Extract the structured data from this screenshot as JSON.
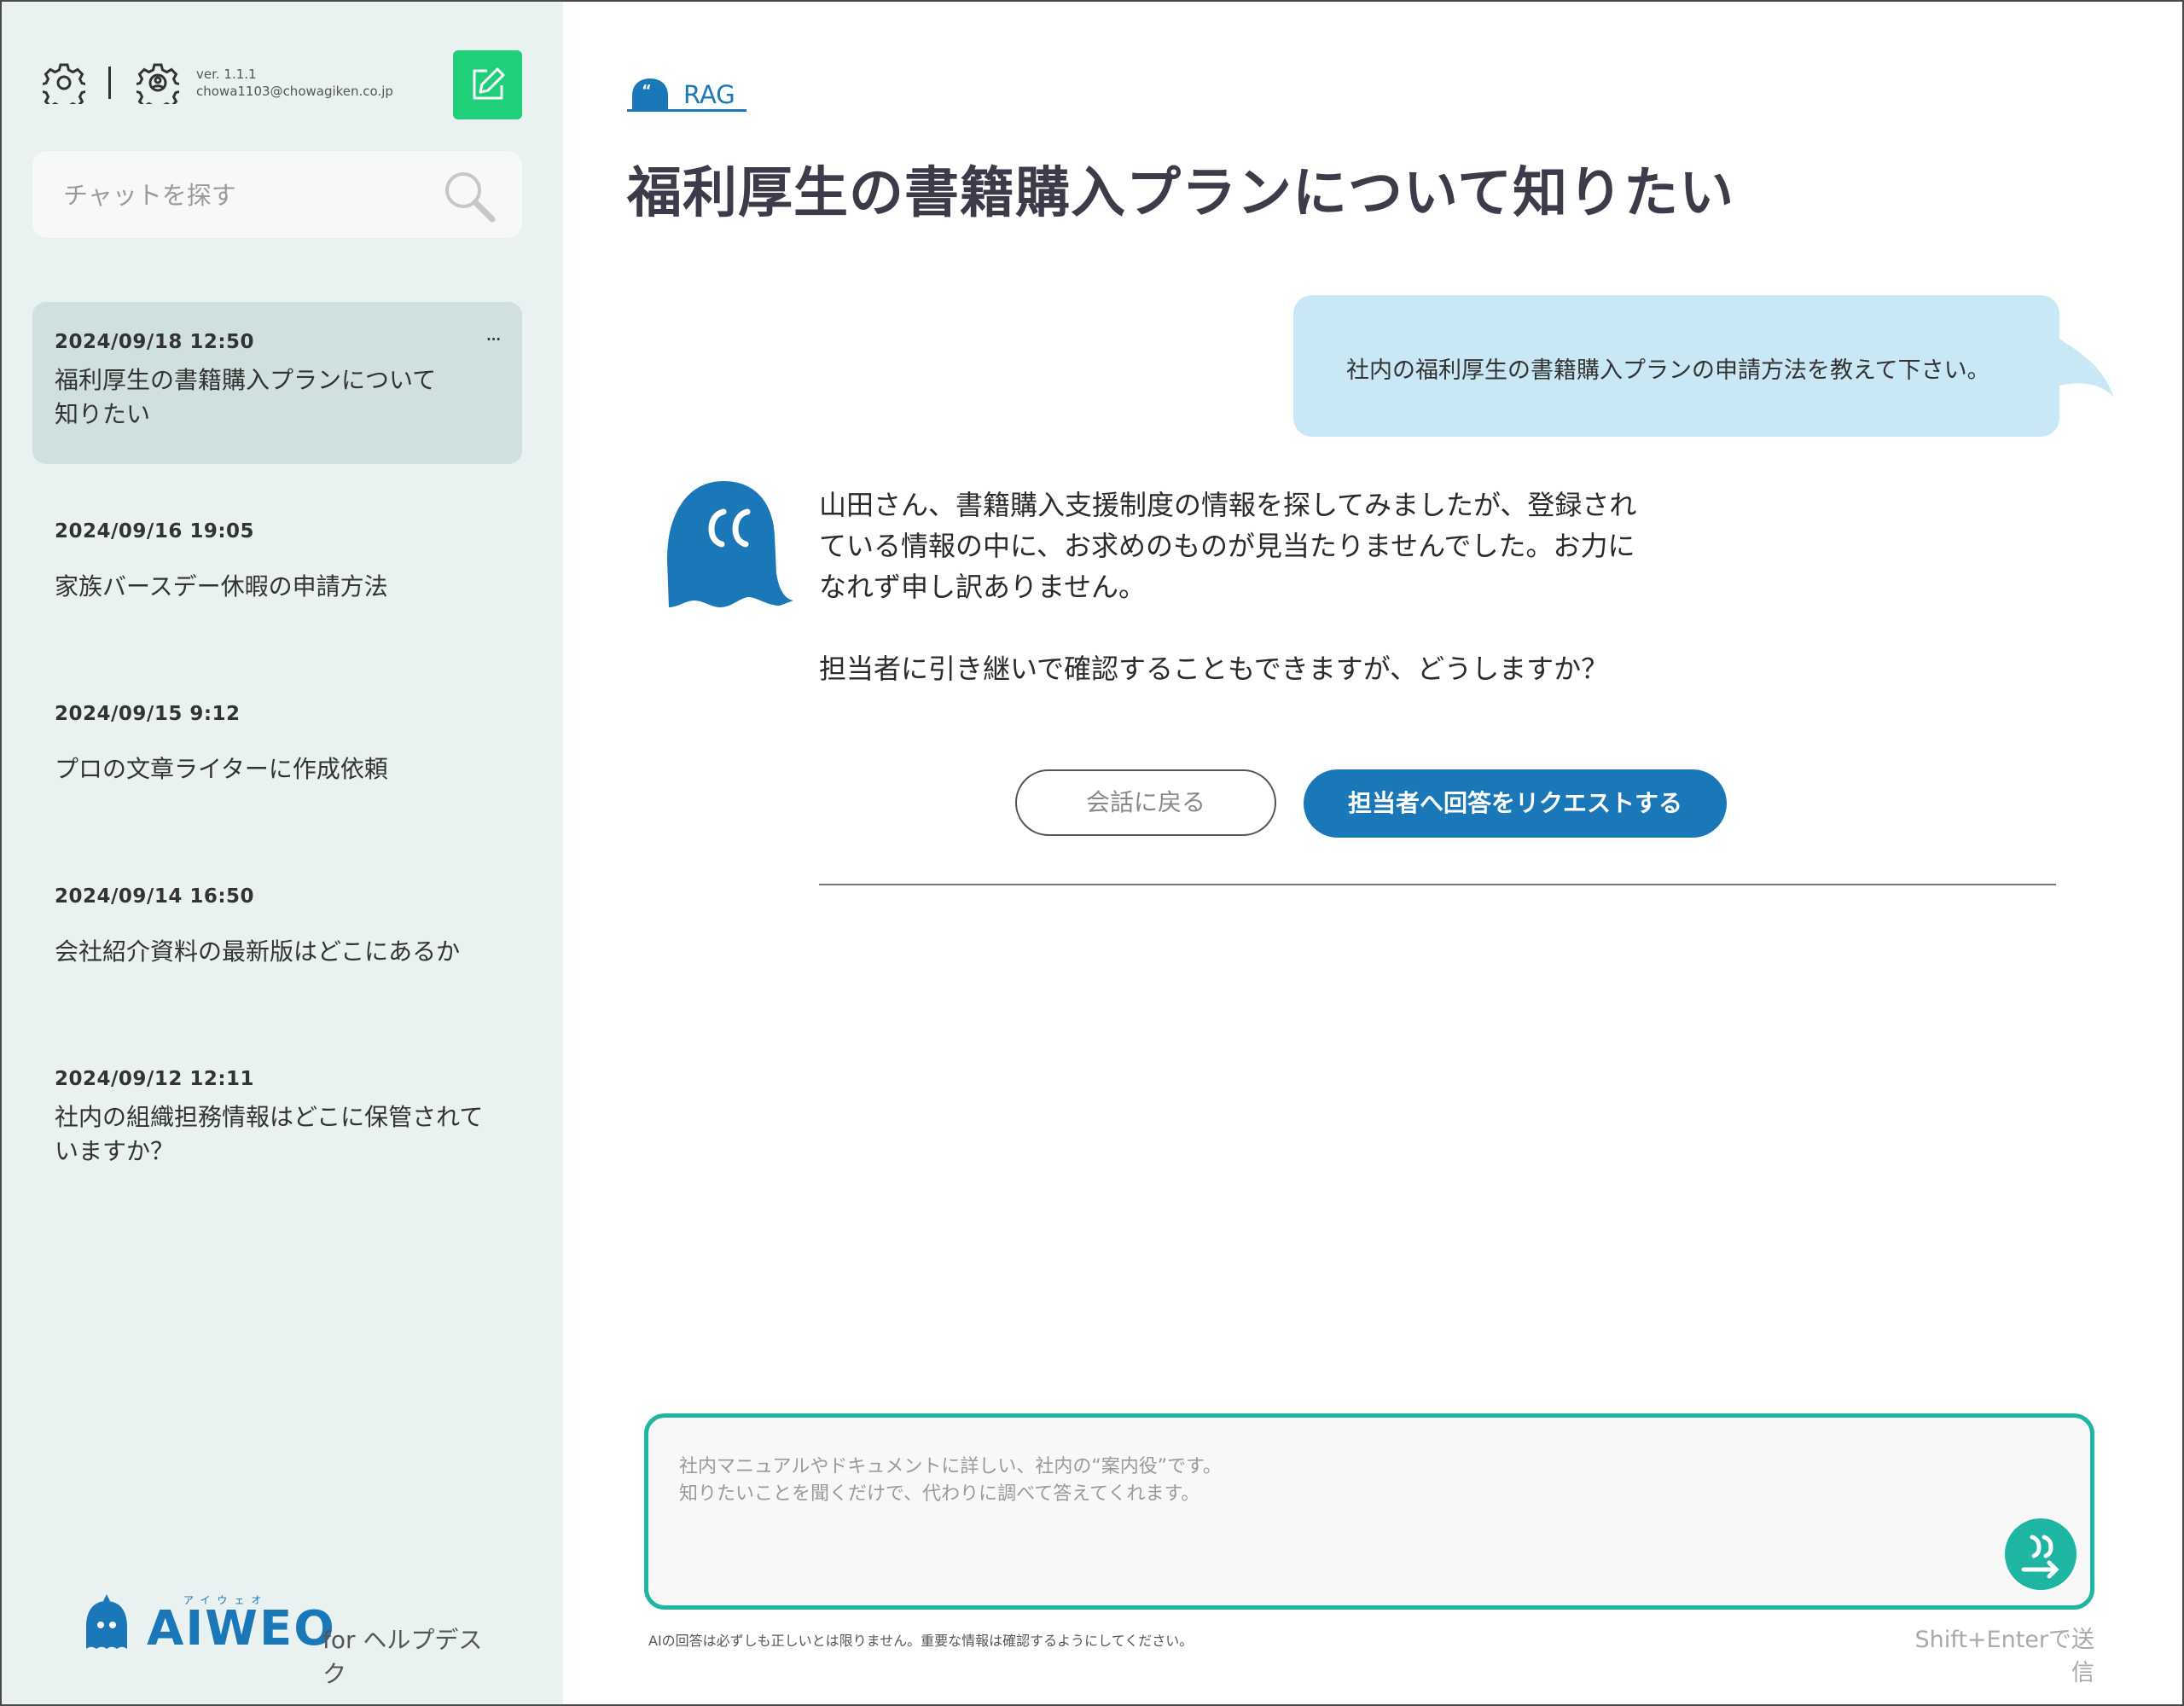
{
  "sidebar": {
    "version": "ver. 1.1.1",
    "email": "chowa1103@chowagiken.co.jp",
    "search_placeholder": "チャットを探す",
    "history": [
      {
        "date": "2024/09/18 12:50",
        "title": "福利厚生の書籍購入プランについて知りたい",
        "more": "···"
      },
      {
        "date": "2024/09/16 19:05",
        "title": "家族バースデー休暇の申請方法"
      },
      {
        "date": "2024/09/15 9:12",
        "title": "プロの文章ライターに作成依頼"
      },
      {
        "date": "2024/09/14 16:50",
        "title": "会社紹介資料の最新版はどこにあるか"
      },
      {
        "date": "2024/09/12 12:11",
        "title": "社内の組織担務情報はどこに保管されていますか？"
      }
    ],
    "brand": {
      "kana": "アイウェオ",
      "name": "AIWEO",
      "suffix": "for ヘルプデスク"
    }
  },
  "main": {
    "tag": "RAG",
    "title": "福利厚生の書籍購入プランについて知りたい",
    "user_message": "社内の福利厚生の書籍購入プランの申請方法を教えて下さい。",
    "bot_message": [
      "山田さん、書籍購入支援制度の情報を探してみましたが、登録されている情報の中に、お求めのものが見当たりませんでした。お力になれず申し訳ありません。",
      "担当者に引き継いで確認することもできますが、どうしますか？"
    ],
    "buttons": {
      "back": "会話に戻る",
      "request": "担当者へ回答をリクエストする"
    },
    "composer_placeholder": "社内マニュアルやドキュメントに詳しい、社内の“案内役”です。\n知りたいことを聞くだけで、代わりに調べて答えてくれます。",
    "disclaimer": "AIの回答は必ずしも正しいとは限りません。重要な情報は確認するようにしてください。",
    "hint": "Shift+Enterで送信"
  },
  "colors": {
    "accent": "#1a77b8",
    "teal": "#1fb5a3",
    "green": "#1fcf7a",
    "sidebar_bg": "#e9f1f1",
    "bubble": "#c9e7f4"
  }
}
